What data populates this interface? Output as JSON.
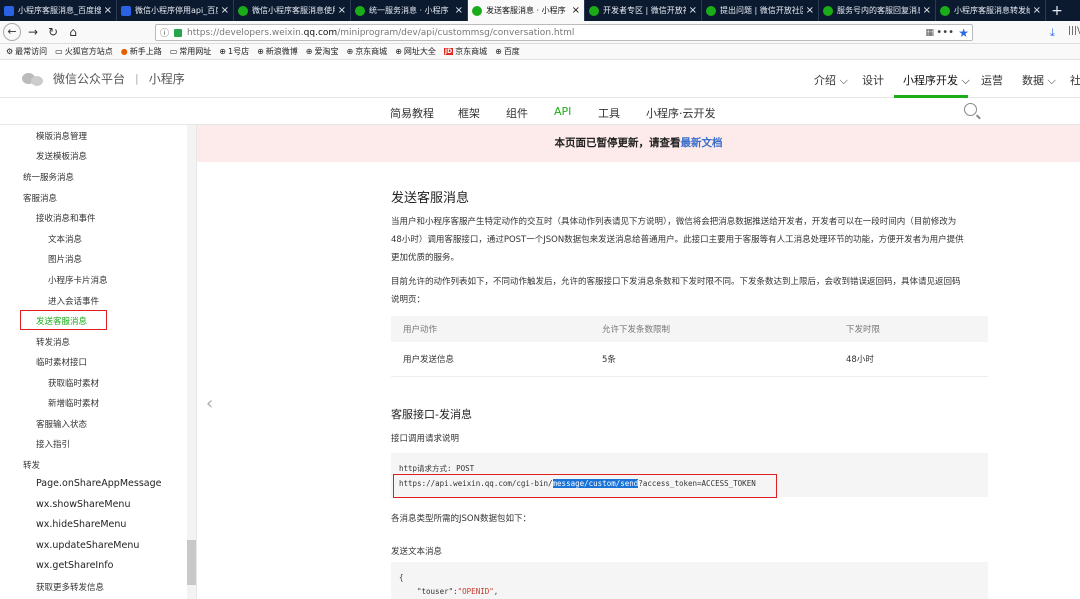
{
  "browser": {
    "tabs": [
      {
        "title": "小程序客服消息_百度搜",
        "fav": "baidu"
      },
      {
        "title": "微信小程序停用api_百度",
        "fav": "baidu"
      },
      {
        "title": "微信小程序客服消息使用",
        "fav": "wx"
      },
      {
        "title": "统一服务消息 · 小程序",
        "fav": "wx"
      },
      {
        "title": "发送客服消息 · 小程序",
        "fav": "wx",
        "active": true
      },
      {
        "title": "开发者专区 | 微信开放社",
        "fav": "wx"
      },
      {
        "title": "提出问题 | 微信开放社区",
        "fav": "wx"
      },
      {
        "title": "服务号内的客服回复消息",
        "fav": "wx"
      },
      {
        "title": "小程序客服消息转发给个",
        "fav": "wx"
      }
    ],
    "new_tab": "+",
    "url_prefix": "https://developers.weixin.",
    "url_domain": "qq.com",
    "url_path": "/miniprogram/dev/api/custommsg/conversation.html",
    "url_menu": "•••",
    "bookmarks": [
      {
        "icon": "gear-icon",
        "label": "最常访问"
      },
      {
        "icon": "folder-icon",
        "label": "火狐官方站点"
      },
      {
        "icon": "firefox-icon",
        "label": "新手上路"
      },
      {
        "icon": "folder-icon",
        "label": "常用网址"
      },
      {
        "icon": "globe-icon",
        "label": "1号店"
      },
      {
        "icon": "globe-icon",
        "label": "新浪微博"
      },
      {
        "icon": "globe-icon",
        "label": "爱淘宝"
      },
      {
        "icon": "globe-icon",
        "label": "京东商城"
      },
      {
        "icon": "globe-icon",
        "label": "网址大全"
      },
      {
        "icon": "jd-icon",
        "label": "京东商城"
      },
      {
        "icon": "globe-icon",
        "label": "百度"
      }
    ]
  },
  "header": {
    "brand": "微信公众平台",
    "sep": "|",
    "product": "小程序",
    "nav": [
      "介绍 ⌵",
      "设计",
      "小程序开发 ⌵",
      "运营",
      "数据 ⌵",
      "社"
    ]
  },
  "subnav": [
    "简易教程",
    "框架",
    "组件",
    "API",
    "工具",
    "小程序·云开发"
  ],
  "sidebar": {
    "items": [
      "模版消息管理",
      "发送模板消息",
      "统一服务消息",
      "客服消息",
      "接收消息和事件",
      "文本消息",
      "图片消息",
      "小程序卡片消息",
      "进入会话事件",
      "发送客服消息",
      "转发消息",
      "临时素材接口",
      "获取临时素材",
      "新增临时素材",
      "客服输入状态",
      "接入指引",
      "转发",
      "Page.onShareAppMessage",
      "wx.showShareMenu",
      "wx.hideShareMenu",
      "wx.updateShareMenu",
      "wx.getShareInfo",
      "获取更多转发信息"
    ]
  },
  "banner": {
    "text": "本页面已暂停更新，请查看",
    "link": "最新文档"
  },
  "content": {
    "title": "发送客服消息",
    "para1_l1": "当用户和小程序客服产生特定动作的交互时（具体动作列表请见下方说明），微信将会把消息数据推送给开发者，开发者可以在一段时间内（目前修改为",
    "para1_l2": "48小时）调用客服接口，通过POST一个JSON数据包来发送消息给普通用户。此接口主要用于客服等有人工消息处理环节的功能，方便开发者为用户提供",
    "para1_l3": "更加优质的服务。",
    "para2_l1": "目前允许的动作列表如下，不同动作触发后，允许的客服接口下发消息条数和下发时限不同。下发条数达到上限后，会收到错误返回码，具体请见返回码",
    "para2_l2": "说明页：",
    "table": {
      "headers": [
        "用户动作",
        "允许下发条数限制",
        "下发时限"
      ],
      "rows": [
        [
          "用户发送信息",
          "5条",
          "48小时"
        ]
      ]
    },
    "api_title": "客服接口-发消息",
    "api_sub": "接口调用请求说明",
    "code_method": "http请求方式: POST",
    "code_url_pre": "https://api.weixin.qq.com/cgi-bin/",
    "code_url_sel": "message/custom/send",
    "code_url_post": "?access_token=ACCESS_TOKEN",
    "json_intro": "各消息类型所需的JSON数据包如下：",
    "text_msg": "发送文本消息",
    "code2_l1": "{",
    "code2_key": "\"touser\"",
    "code2_colon": ":",
    "code2_val": "\"OPENID\"",
    "code2_comma": ","
  }
}
